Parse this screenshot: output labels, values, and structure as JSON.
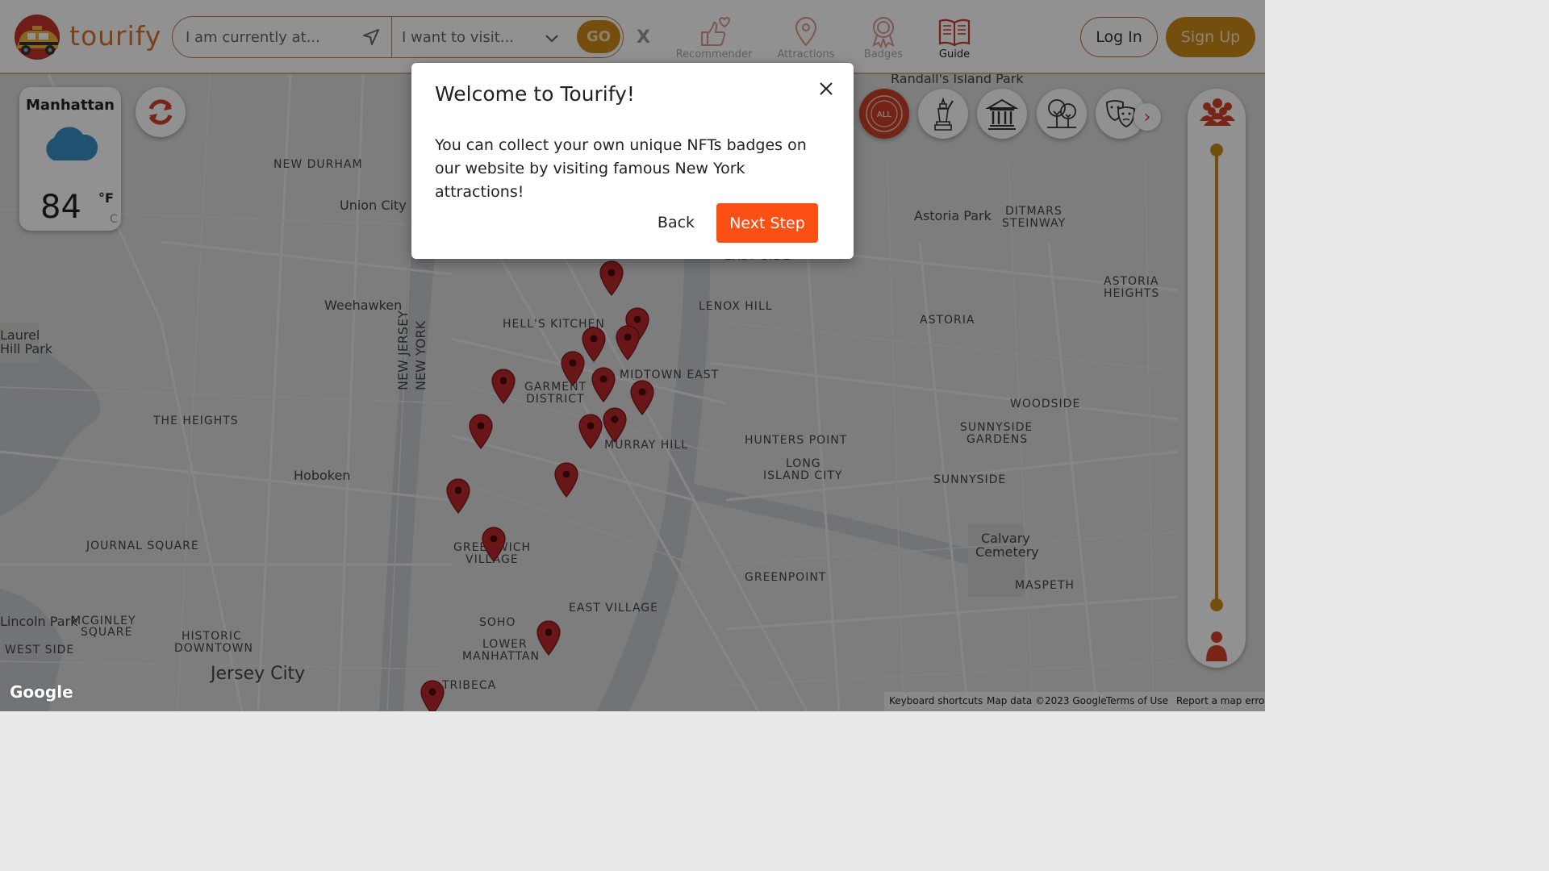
{
  "app": {
    "name": "tourify"
  },
  "search": {
    "from_placeholder": "I am currently at...",
    "to_placeholder": "I want to visit...",
    "go_label": "GO",
    "clear_label": "X"
  },
  "nav": {
    "items": [
      {
        "label": "Recommender",
        "icon": "thumbs-up-heart-icon",
        "active": false
      },
      {
        "label": "Attractions",
        "icon": "map-pin-icon",
        "active": false
      },
      {
        "label": "Badges",
        "icon": "award-badge-icon",
        "active": false
      },
      {
        "label": "Guide",
        "icon": "open-book-icon",
        "active": true
      }
    ]
  },
  "auth": {
    "login_label": "Log In",
    "signup_label": "Sign Up"
  },
  "weather": {
    "city": "Manhattan",
    "temperature": "84",
    "unit_f": "°F",
    "unit_c": "C",
    "icon": "cloud-icon"
  },
  "categories": [
    {
      "name": "all",
      "label": "ALL"
    },
    {
      "name": "statue-of-liberty"
    },
    {
      "name": "museum"
    },
    {
      "name": "park"
    },
    {
      "name": "theatre"
    }
  ],
  "map": {
    "neighborhoods": [
      "NEW DURHAM",
      "HELL'S KITCHEN",
      "LENOX HILL",
      "MIDTOWN EAST",
      "GARMENT",
      "DISTRICT",
      "MURRAY HILL",
      "THE HEIGHTS",
      "JOURNAL SQUARE",
      "GREENWICH",
      "VILLAGE",
      "EAST VILLAGE",
      "SOHO",
      "LOWER",
      "MANHATTAN",
      "TRIBECA",
      "HISTORIC",
      "DOWNTOWN",
      "WEST SIDE",
      "MCGINLEY",
      "SQUARE",
      "ASTORIA",
      "DITMARS",
      "STEINWAY",
      "ASTORIA",
      "HEIGHTS",
      "WOODSIDE",
      "SUNNYSIDE",
      "GARDENS",
      "HUNTERS POINT",
      "LONG",
      "ISLAND CITY",
      "SUNNYSIDE",
      "GREENPOINT",
      "MASPETH",
      "NEW JERSEY",
      "NEW YORK",
      "EAST SIDE"
    ],
    "places": [
      "Union City",
      "Weehawken",
      "Hoboken",
      "Jersey City",
      "Astoria Park",
      "Calvary",
      "Cemetery",
      "Randall's Island Park",
      "Laurel",
      "Hill Park",
      "Lincoln Park"
    ],
    "attribution": {
      "keyboard": "Keyboard shortcuts",
      "data": "Map data ©2023 Google",
      "terms": "Terms of Use",
      "report": "Report a map error"
    },
    "google": "Google"
  },
  "modal": {
    "title": "Welcome to Tourify!",
    "body": "You can collect your own unique NFTs badges on our website by visiting famous New York attractions!",
    "back_label": "Back",
    "next_label": "Next Step"
  },
  "colors": {
    "brand_orange": "#d8742e",
    "gold": "#cc8a17",
    "cta": "#fc4f13",
    "pin_red": "#b8282a"
  }
}
